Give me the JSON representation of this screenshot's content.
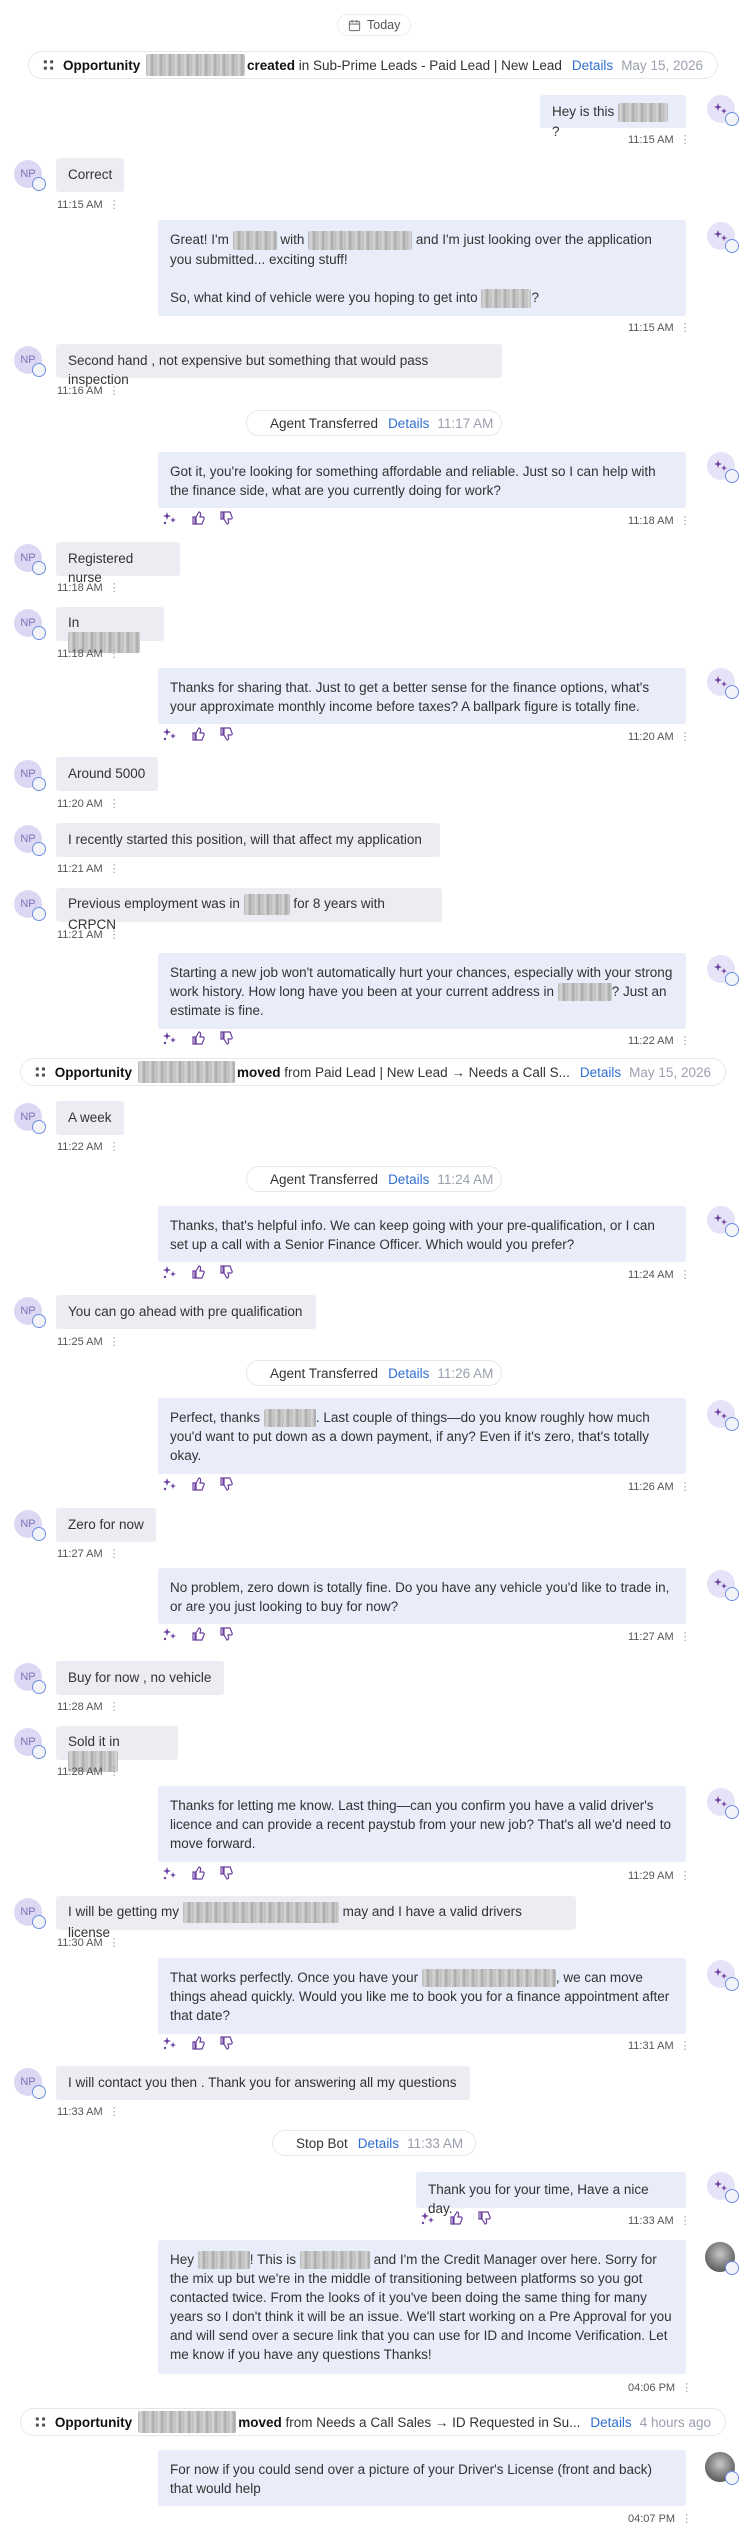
{
  "date_header": "Today",
  "common": {
    "details": "Details",
    "dots": "⋮"
  },
  "events": {
    "opp1": {
      "title": "Opportunity",
      "action": "created",
      "rest": "in Sub-Prime Leads - Paid Lead | New Lead",
      "time": "May 15, 2026"
    },
    "opp2": {
      "title": "Opportunity",
      "action": "moved",
      "rest": "from Paid Lead | New Lead → Needs a Call S...",
      "time": "May 15, 2026"
    },
    "opp3": {
      "title": "Opportunity",
      "action": "moved",
      "rest": "from Needs a Call Sales → ID Requested in Su...",
      "time": "4 hours ago"
    },
    "agent1": {
      "label": "Agent Transferred",
      "time": "11:17 AM"
    },
    "agent2": {
      "label": "Agent Transferred",
      "time": "11:24 AM"
    },
    "agent3": {
      "label": "Agent Transferred",
      "time": "11:26 AM"
    },
    "stop": {
      "label": "Stop Bot",
      "time": "11:33 AM"
    }
  },
  "contact_initials": "NP",
  "messages": {
    "m1": {
      "a": "Hey is this",
      "b": "?",
      "time": "11:15 AM"
    },
    "m2": {
      "text": "Correct",
      "time": "11:15 AM"
    },
    "m3": {
      "a": "Great! I'm",
      "b": "with",
      "c": "and I'm just looking over the application you submitted... exciting stuff!",
      "p2a": "So, what kind of vehicle were you hoping to get into",
      "p2b": "?",
      "time": "11:15 AM"
    },
    "m4": {
      "text": "Second hand , not expensive but something that would pass inspection",
      "time": "11:16 AM"
    },
    "m5": {
      "text": "Got it, you're looking for something affordable and reliable. Just so I can help with the finance side, what are you currently doing for work?",
      "time": "11:18 AM"
    },
    "m6": {
      "text": "Registered nurse",
      "time": "11:18 AM"
    },
    "m7": {
      "text": "In",
      "time": "11:18 AM"
    },
    "m8": {
      "text": "Thanks for sharing that. Just to get a better sense for the finance options, what's your approximate monthly income before taxes? A ballpark figure is totally fine.",
      "time": "11:20 AM"
    },
    "m9": {
      "text": "Around 5000",
      "time": "11:20 AM"
    },
    "m10": {
      "text": "I recently started this position, will that affect my application",
      "time": "11:21 AM"
    },
    "m11": {
      "a": "Previous employment was in",
      "b": "for 8 years with CRPCN",
      "time": "11:21 AM"
    },
    "m12": {
      "a": "Starting a new job won't automatically hurt your chances, especially with your strong work history. How long have you been at your current address in",
      "b": "? Just an estimate is fine.",
      "time": "11:22 AM"
    },
    "m13": {
      "text": "A week",
      "time": "11:22 AM"
    },
    "m14": {
      "text": "Thanks, that's helpful info. We can keep going with your pre-qualification, or I can set up a call with a Senior Finance Officer. Which would you prefer?",
      "time": "11:24 AM"
    },
    "m15": {
      "text": "You can go ahead with pre qualification",
      "time": "11:25 AM"
    },
    "m16": {
      "a": "Perfect, thanks",
      "b": ". Last couple of things—do you know roughly how much you'd want to put down as a down payment, if any? Even if it's zero, that's totally okay.",
      "time": "11:26 AM"
    },
    "m17": {
      "text": "Zero for now",
      "time": "11:27 AM"
    },
    "m18": {
      "text": "No problem, zero down is totally fine. Do you have any vehicle you'd like to trade in, or are you just looking to buy for now?",
      "time": "11:27 AM"
    },
    "m19": {
      "text": "Buy for now , no vehicle",
      "time": "11:28 AM"
    },
    "m20": {
      "text": "Sold it in",
      "time": "11:28 AM"
    },
    "m21": {
      "text": "Thanks for letting me know. Last thing—can you confirm you have a valid driver's licence and can provide a recent paystub from your new job? That's all we'd need to move forward.",
      "time": "11:29 AM"
    },
    "m22": {
      "a": "I will be getting my",
      "b": "may and I have a valid drivers license",
      "time": "11:30 AM"
    },
    "m23": {
      "a": "That works perfectly. Once you have your",
      "b": ", we can move things ahead quickly. Would you like me to book you for a finance appointment after that date?",
      "time": "11:31 AM"
    },
    "m24": {
      "text": "I will contact you then . Thank you for answering all my questions",
      "time": "11:33 AM"
    },
    "m25": {
      "text": "Thank you for your time, Have a nice day.",
      "time": "11:33 AM"
    },
    "m26": {
      "a": "Hey",
      "b": "! This is",
      "c": "and I'm the Credit Manager over here. Sorry for the mix up but we're in the middle of transitioning between platforms so you got contacted twice. From the looks of it you've been doing the same thing for many years so I don't think it will be an issue. We'll start working on a Pre Approval for you and will send over a secure link that you can use for ID and Income Verification. Let me know if you have any questions Thanks!",
      "time": "04:06 PM"
    },
    "m27": {
      "text": "For now if you could send over a picture of your Driver's License (front and back) that would help",
      "time": "04:07 PM"
    }
  },
  "colors": {
    "accent": "#2f6fd1",
    "bot_icon": "#6b3fa0",
    "outgoing_bubble": "#e9ecf9",
    "incoming_bubble": "#ececf3"
  }
}
